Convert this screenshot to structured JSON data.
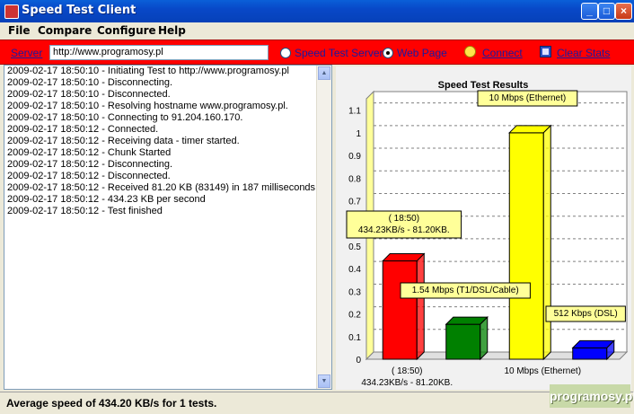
{
  "window": {
    "title": "Speed Test Client",
    "minimize": "_",
    "maximize": "□",
    "close": "×"
  },
  "menu": [
    "File",
    "Compare",
    "Configure",
    "Help"
  ],
  "toolbar": {
    "server_label": "Server",
    "server_value": "http://www.programosy.pl",
    "radio_speed": "Speed Test Server",
    "radio_web": "Web Page",
    "selected_radio": "Web Page",
    "connect": "Connect",
    "clear": "Clear Stats"
  },
  "log": [
    "2009-02-17 18:50:10 - Initiating Test to http://www.programosy.pl",
    "2009-02-17 18:50:10 - Disconnecting.",
    "2009-02-17 18:50:10 - Disconnected.",
    "2009-02-17 18:50:10 - Resolving hostname www.programosy.pl.",
    "2009-02-17 18:50:10 - Connecting to 91.204.160.170.",
    "2009-02-17 18:50:12 - Connected.",
    "2009-02-17 18:50:12 - Receiving data - timer started.",
    "2009-02-17 18:50:12 - Chunk Started",
    "2009-02-17 18:50:12 - Disconnecting.",
    "2009-02-17 18:50:12 - Disconnected.",
    "2009-02-17 18:50:12 - Received 81.20 KB (83149) in 187 milliseconds",
    "2009-02-17 18:50:12 - 434.23 KB per second",
    "2009-02-17 18:50:12 - Test finished"
  ],
  "chart_data": {
    "type": "bar",
    "title": "Speed Test Results",
    "ylim": [
      0,
      1.15
    ],
    "yticks": [
      0,
      0.1,
      0.2,
      0.3,
      0.4,
      0.5,
      0.6,
      0.7,
      0.8,
      0.9,
      1,
      1.1
    ],
    "grid": true,
    "bars": [
      {
        "label": "( 18:50)\n434.23KB/s - 81.20KB.",
        "value": 0.434,
        "color": "#ff0000"
      },
      {
        "label": "1.54 Mbps (T1/DSL/Cable)",
        "value": 0.154,
        "color": "#008000"
      },
      {
        "label": "10 Mbps (Ethernet)",
        "value": 1.0,
        "color": "#ffff00"
      },
      {
        "label": "512 Kbps (DSL)",
        "value": 0.05,
        "color": "#0000ff"
      }
    ],
    "xlabels": [
      {
        "text": "( 18:50)\n434.23KB/s - 81.20KB.",
        "bar": 0
      },
      {
        "text": "10 Mbps (Ethernet)",
        "bar": 2
      }
    ]
  },
  "status": "Average speed of 434.20 KB/s for 1 tests.",
  "watermark": "programosy.pl",
  "colors": {
    "toolbar": "#ff0000",
    "link": "#1a1aa0"
  }
}
